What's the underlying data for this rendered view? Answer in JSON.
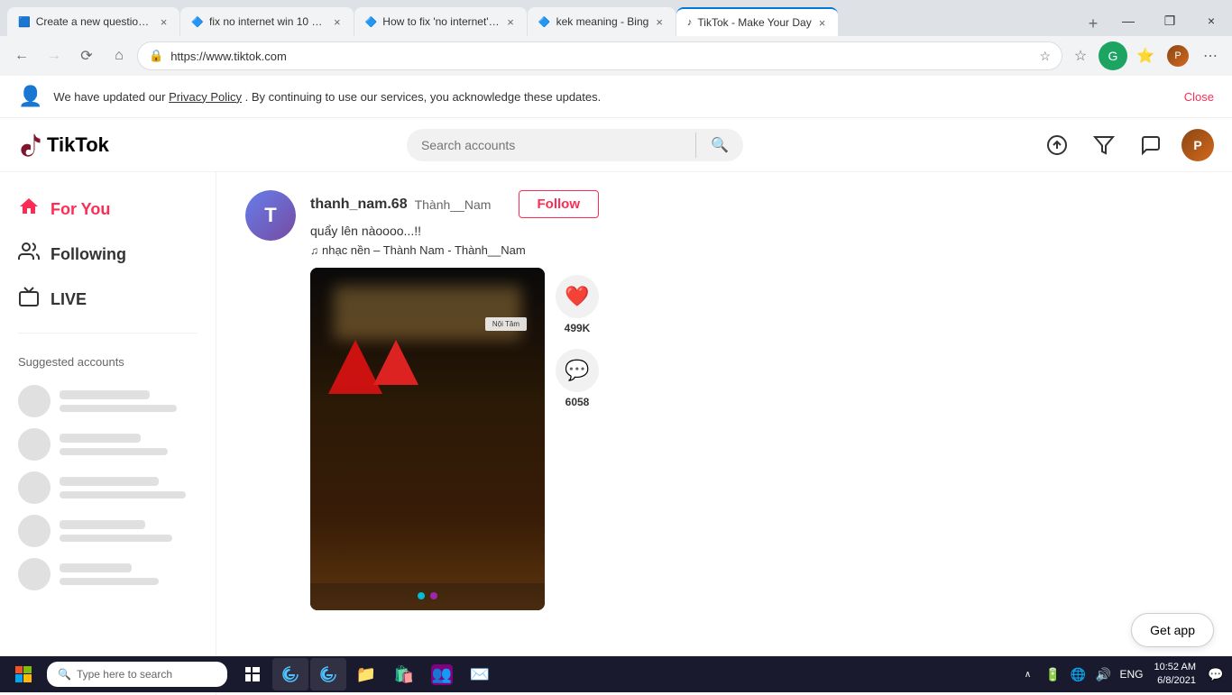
{
  "browser": {
    "tabs": [
      {
        "id": "tab1",
        "title": "Create a new question or sta",
        "favicon": "🟦",
        "active": false,
        "close": "×"
      },
      {
        "id": "tab2",
        "title": "fix no internet win 10 2004 -",
        "favicon": "🔷",
        "active": false,
        "close": "×"
      },
      {
        "id": "tab3",
        "title": "How to fix 'no internet' conn...",
        "favicon": "🔷",
        "active": false,
        "close": "×"
      },
      {
        "id": "tab4",
        "title": "kek meaning - Bing",
        "favicon": "🔷",
        "active": false,
        "close": "×"
      },
      {
        "id": "tab5",
        "title": "TikTok - Make Your Day",
        "favicon": "♪",
        "active": true,
        "close": "×"
      }
    ],
    "new_tab_label": "+",
    "window_controls": [
      "—",
      "❐",
      "×"
    ],
    "address": "https://www.tiktok.com",
    "nav": {
      "back_disabled": false,
      "forward_disabled": true,
      "reload": "⟳",
      "home": "⌂"
    },
    "toolbar_icons": [
      "☆",
      "⬛",
      "💬",
      "⋯"
    ]
  },
  "privacy_banner": {
    "text_before": "We have updated our",
    "link": "Privacy Policy",
    "text_after": ". By continuing to use our services, you acknowledge these updates.",
    "close_label": "Close"
  },
  "header": {
    "logo_icon": "♪",
    "logo_text": "TikTok",
    "search_placeholder": "Search accounts",
    "upload_icon": "upload",
    "filter_icon": "filter",
    "message_icon": "message"
  },
  "sidebar": {
    "nav_items": [
      {
        "id": "for-you",
        "label": "For You",
        "icon": "🏠",
        "active": true
      },
      {
        "id": "following",
        "label": "Following",
        "icon": "👥",
        "active": false
      },
      {
        "id": "live",
        "label": "LIVE",
        "icon": "📹",
        "active": false
      }
    ],
    "suggested_title": "Suggested accounts",
    "suggested_accounts": [
      {
        "id": "acc1"
      },
      {
        "id": "acc2"
      },
      {
        "id": "acc3"
      },
      {
        "id": "acc4"
      },
      {
        "id": "acc5"
      }
    ]
  },
  "video_feed": {
    "items": [
      {
        "id": "video1",
        "author": {
          "username": "thanh_nam.68",
          "display_name": "Thành__Nam",
          "avatar_letter": "T"
        },
        "caption": "quẩy lên nàoooo...!!",
        "music_note": "♫",
        "music": "nhạc nền – Thành Nam - Thành__Nam",
        "follow_label": "Follow",
        "likes": "499K",
        "comments": "6058",
        "dots": [
          {
            "color": "#00bcd4"
          },
          {
            "color": "#9c27b0"
          }
        ]
      }
    ]
  },
  "get_app": {
    "label": "Get app"
  },
  "taskbar": {
    "start_icon": "⊞",
    "search_placeholder": "Type here to search",
    "search_icon": "🔍",
    "apps": [
      {
        "id": "cortana",
        "icon": "⭕"
      },
      {
        "id": "taskview",
        "icon": "🗔"
      },
      {
        "id": "edge",
        "icon": "🌀"
      },
      {
        "id": "edge2",
        "icon": "🌀"
      },
      {
        "id": "explorer",
        "icon": "📁"
      },
      {
        "id": "store",
        "icon": "🛍️"
      },
      {
        "id": "teams",
        "icon": "👥"
      },
      {
        "id": "mail",
        "icon": "✉️"
      }
    ],
    "system_icons": [
      "∧",
      "🔋",
      "🔊",
      "🌐",
      "💬"
    ],
    "language": "ENG",
    "time": "10:52 AM",
    "date": "6/8/2021",
    "notification_icon": "💬"
  }
}
